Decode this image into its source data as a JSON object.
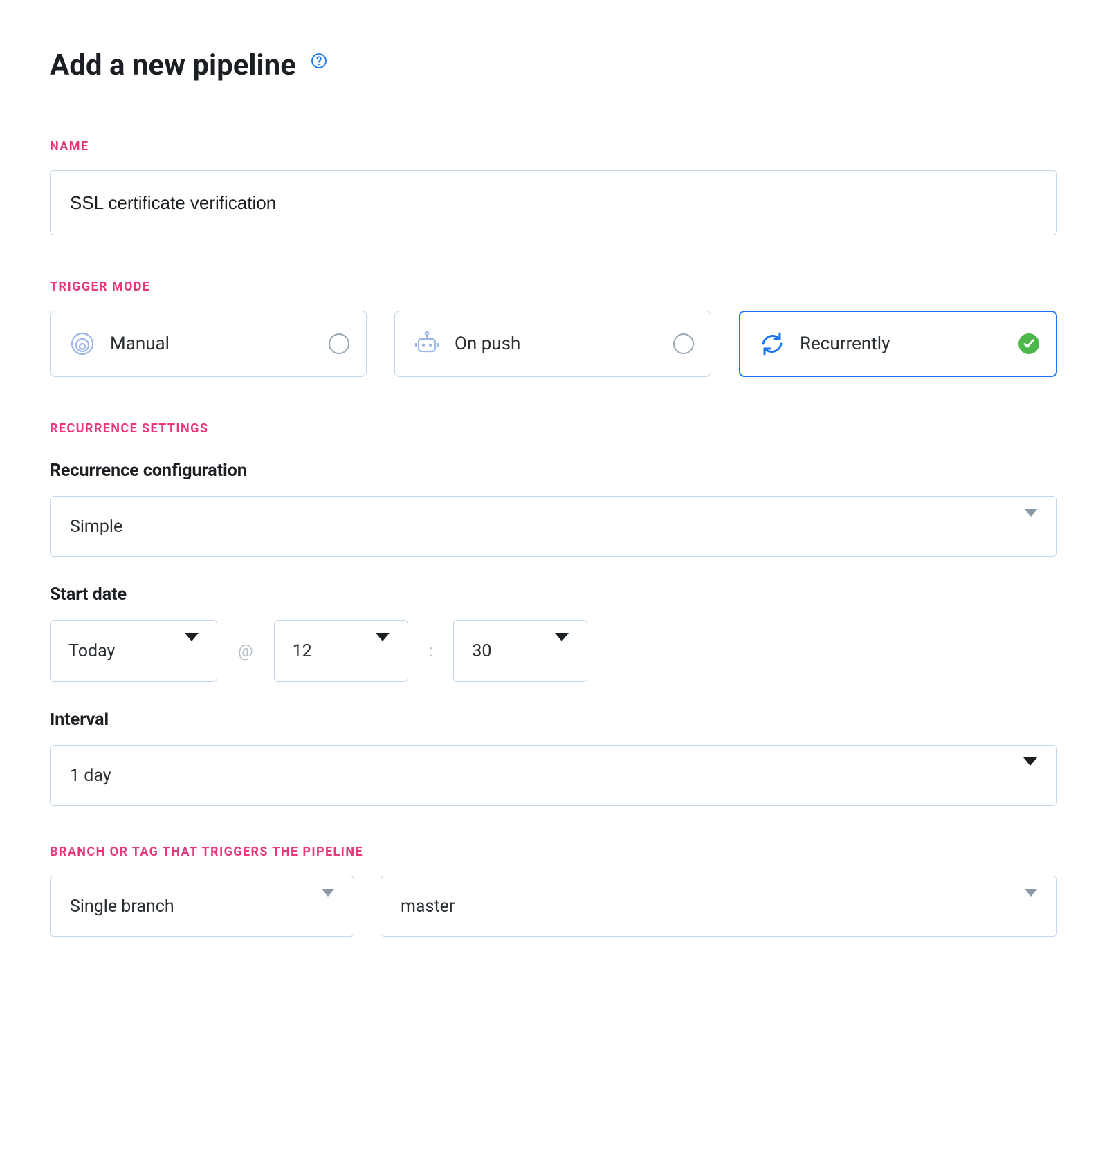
{
  "header": {
    "title": "Add a new pipeline"
  },
  "name_section": {
    "label": "NAME",
    "value": "SSL certificate verification"
  },
  "trigger_section": {
    "label": "TRIGGER MODE",
    "options": [
      {
        "label": "Manual",
        "selected": false
      },
      {
        "label": "On push",
        "selected": false
      },
      {
        "label": "Recurrently",
        "selected": true
      }
    ]
  },
  "recurrence_section": {
    "label": "RECURRENCE SETTINGS",
    "config_label": "Recurrence configuration",
    "config_value": "Simple",
    "start_label": "Start date",
    "start_day": "Today",
    "at_sep": "@",
    "start_hour": "12",
    "colon_sep": ":",
    "start_minute": "30",
    "interval_label": "Interval",
    "interval_value": "1 day"
  },
  "branch_section": {
    "label": "BRANCH OR TAG THAT TRIGGERS THE PIPELINE",
    "type_value": "Single branch",
    "name_value": "master"
  }
}
